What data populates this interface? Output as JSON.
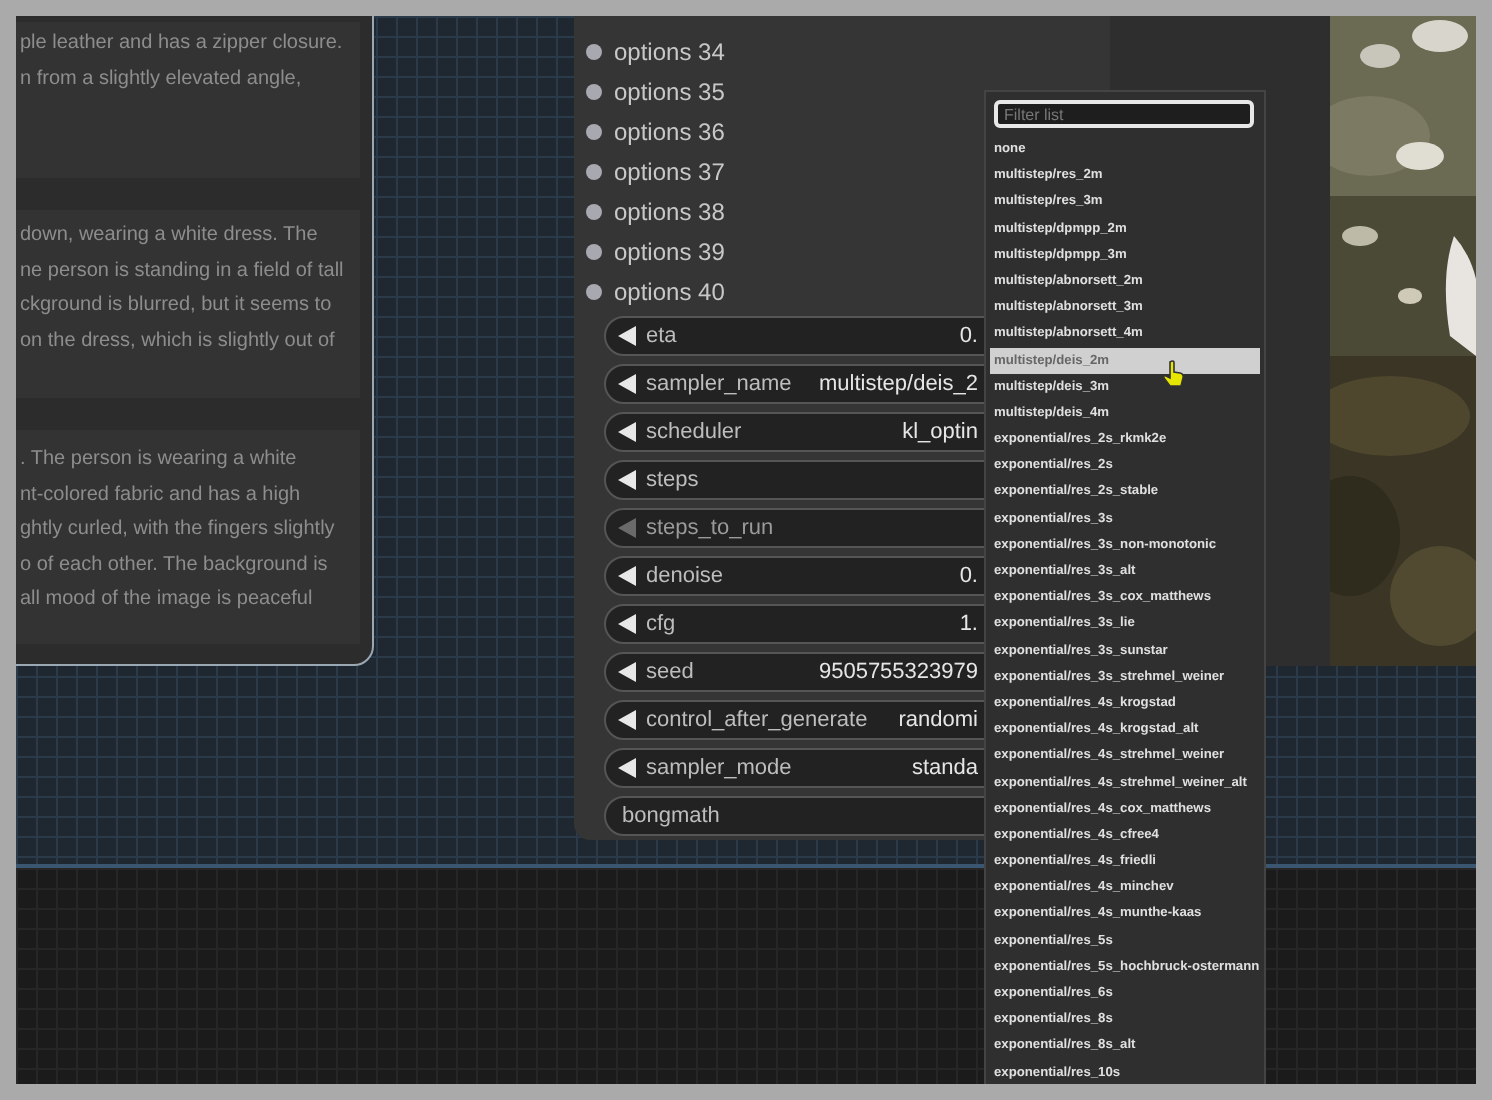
{
  "text_panel": {
    "cards": [
      {
        "lines": [
          "ple leather and has a zipper closure.",
          "n from a slightly elevated angle,"
        ]
      },
      {
        "lines": [
          "down, wearing a white dress. The",
          "ne person is standing in a field of tall",
          "ckground is blurred, but it seems to",
          " on the dress, which is slightly out of"
        ]
      },
      {
        "lines": [
          ". The person is wearing a white",
          "nt-colored fabric and has a high",
          "ghtly curled, with the fingers slightly",
          "o of each other. The background is",
          "all mood of the image is peaceful"
        ]
      }
    ]
  },
  "node": {
    "outputs": [
      {
        "label": "options 34"
      },
      {
        "label": "options 35"
      },
      {
        "label": "options 36"
      },
      {
        "label": "options 37"
      },
      {
        "label": "options 38"
      },
      {
        "label": "options 39"
      },
      {
        "label": "options 40"
      }
    ],
    "widgets": [
      {
        "kind": "value",
        "label": "eta",
        "value": "0.",
        "disabled": false
      },
      {
        "kind": "value",
        "label": "sampler_name",
        "value": "multistep/deis_2",
        "disabled": false
      },
      {
        "kind": "value",
        "label": "scheduler",
        "value": "kl_optin",
        "disabled": false
      },
      {
        "kind": "value",
        "label": "steps",
        "disabled": false
      },
      {
        "kind": "value",
        "label": "steps_to_run",
        "disabled": true
      },
      {
        "kind": "value",
        "label": "denoise",
        "value": "0.",
        "disabled": false
      },
      {
        "kind": "value",
        "label": "cfg",
        "value": "1.",
        "disabled": false
      },
      {
        "kind": "value",
        "label": "seed",
        "value": "9505755323979",
        "disabled": false
      },
      {
        "kind": "value",
        "label": "control_after_generate",
        "value": "randomi",
        "disabled": false
      },
      {
        "kind": "value",
        "label": "sampler_mode",
        "value": "standa",
        "disabled": false
      },
      {
        "kind": "toggle",
        "label": "bongmath"
      }
    ]
  },
  "dropdown": {
    "placeholder": "Filter list",
    "items": [
      {
        "label": "none",
        "selected": false
      },
      {
        "label": "multistep/res_2m",
        "selected": false
      },
      {
        "label": "multistep/res_3m",
        "selected": false
      },
      {
        "label": "multistep/dpmpp_2m",
        "selected": false
      },
      {
        "label": "multistep/dpmpp_3m",
        "selected": false
      },
      {
        "label": "multistep/abnorsett_2m",
        "selected": false
      },
      {
        "label": "multistep/abnorsett_3m",
        "selected": false
      },
      {
        "label": "multistep/abnorsett_4m",
        "selected": false
      },
      {
        "label": "multistep/deis_2m",
        "selected": true
      },
      {
        "label": "multistep/deis_3m",
        "selected": false
      },
      {
        "label": "multistep/deis_4m",
        "selected": false
      },
      {
        "label": "exponential/res_2s_rkmk2e",
        "selected": false
      },
      {
        "label": "exponential/res_2s",
        "selected": false
      },
      {
        "label": "exponential/res_2s_stable",
        "selected": false
      },
      {
        "label": "exponential/res_3s",
        "selected": false
      },
      {
        "label": "exponential/res_3s_non-monotonic",
        "selected": false
      },
      {
        "label": "exponential/res_3s_alt",
        "selected": false
      },
      {
        "label": "exponential/res_3s_cox_matthews",
        "selected": false
      },
      {
        "label": "exponential/res_3s_lie",
        "selected": false
      },
      {
        "label": "exponential/res_3s_sunstar",
        "selected": false
      },
      {
        "label": "exponential/res_3s_strehmel_weiner",
        "selected": false
      },
      {
        "label": "exponential/res_4s_krogstad",
        "selected": false
      },
      {
        "label": "exponential/res_4s_krogstad_alt",
        "selected": false
      },
      {
        "label": "exponential/res_4s_strehmel_weiner",
        "selected": false
      },
      {
        "label": "exponential/res_4s_strehmel_weiner_alt",
        "selected": false
      },
      {
        "label": "exponential/res_4s_cox_matthews",
        "selected": false
      },
      {
        "label": "exponential/res_4s_cfree4",
        "selected": false
      },
      {
        "label": "exponential/res_4s_friedli",
        "selected": false
      },
      {
        "label": "exponential/res_4s_minchev",
        "selected": false
      },
      {
        "label": "exponential/res_4s_munthe-kaas",
        "selected": false
      },
      {
        "label": "exponential/res_5s",
        "selected": false
      },
      {
        "label": "exponential/res_5s_hochbruck-ostermann",
        "selected": false
      },
      {
        "label": "exponential/res_6s",
        "selected": false
      },
      {
        "label": "exponential/res_8s",
        "selected": false
      },
      {
        "label": "exponential/res_8s_alt",
        "selected": false
      },
      {
        "label": "exponential/res_10s",
        "selected": false
      }
    ]
  }
}
